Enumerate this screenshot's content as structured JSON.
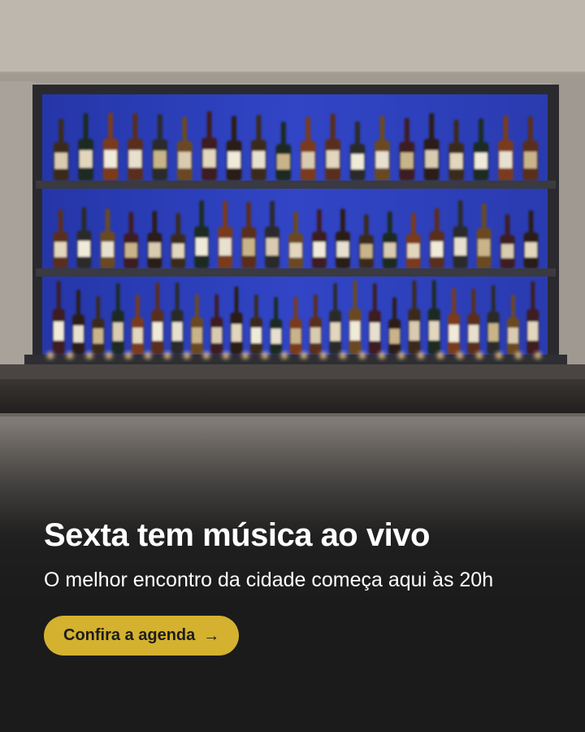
{
  "promo": {
    "headline": "Sexta tem música ao vivo",
    "subtext": "O melhor encontro da cidade começa aqui às 20h",
    "cta_label": "Confira a agenda",
    "cta_icon": "arrow-right-icon",
    "cta_color": "#d4b12f"
  },
  "background": {
    "subject": "bar-shelf-with-bottles",
    "backlight_color": "#2f3fc0"
  }
}
